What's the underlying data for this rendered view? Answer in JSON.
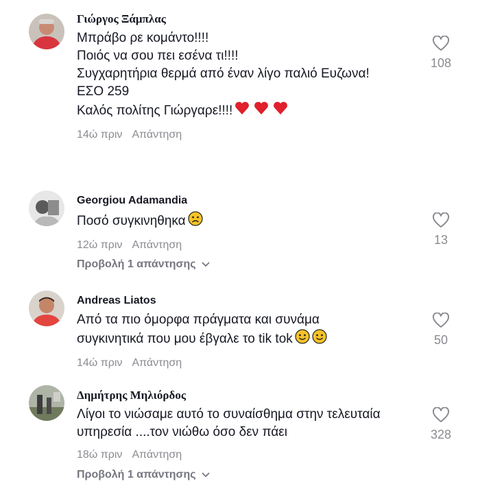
{
  "comments": [
    {
      "username": "Γιώργος Ξάμπλας",
      "lines": [
        "Μπράβο ρε κομάντο!!!!",
        "Ποιός να σου πει εσένα τι!!!!",
        "Συγχαρητήρια θερμά από έναν λίγο παλιό Ευζωνα!",
        "ΕΣΟ 259",
        "Καλός πολίτης Γιώργαρε!!!!"
      ],
      "time": "14ώ πριν",
      "reply_label": "Απάντηση",
      "likes": "108",
      "emoji": "heart"
    },
    {
      "username": "Georgiou Adamandia",
      "lines": [
        "Ποσό συγκινηθηκα"
      ],
      "time": "12ώ πριν",
      "reply_label": "Απάντηση",
      "likes": "13",
      "emoji": "worried",
      "view_replies": "Προβολή 1 απάντησης"
    },
    {
      "username": "Andreas Liatos",
      "lines": [
        "Από τα πιο όμορφα πράγματα και συνάμα",
        "συγκινητικά που μου έβγαλε το tik tok"
      ],
      "time": "14ώ πριν",
      "reply_label": "Απάντηση",
      "likes": "50",
      "emoji": "smile"
    },
    {
      "username": "Δημήτρης Μηλιόρδος",
      "lines": [
        "Λίγοι το νιώσαμε αυτό το συναίσθημα στην τελευταία",
        "υπηρεσία ....τον νιώθω όσο δεν πάει"
      ],
      "time": "18ώ πριν",
      "reply_label": "Απάντηση",
      "likes": "328",
      "view_replies": "Προβολή 1 απάντησης"
    }
  ],
  "icons": {
    "like": "heart-outline-icon",
    "chevron": "chevron-down-icon",
    "emoji_heart": "red-heart-emoji",
    "emoji_worried": "worried-face-emoji",
    "emoji_smile": "smiling-face-emoji"
  },
  "colors": {
    "text": "#161823",
    "muted": "#8a8b91",
    "heart_emoji": "#e0202c",
    "emoji_yellow": "#f7c227"
  }
}
